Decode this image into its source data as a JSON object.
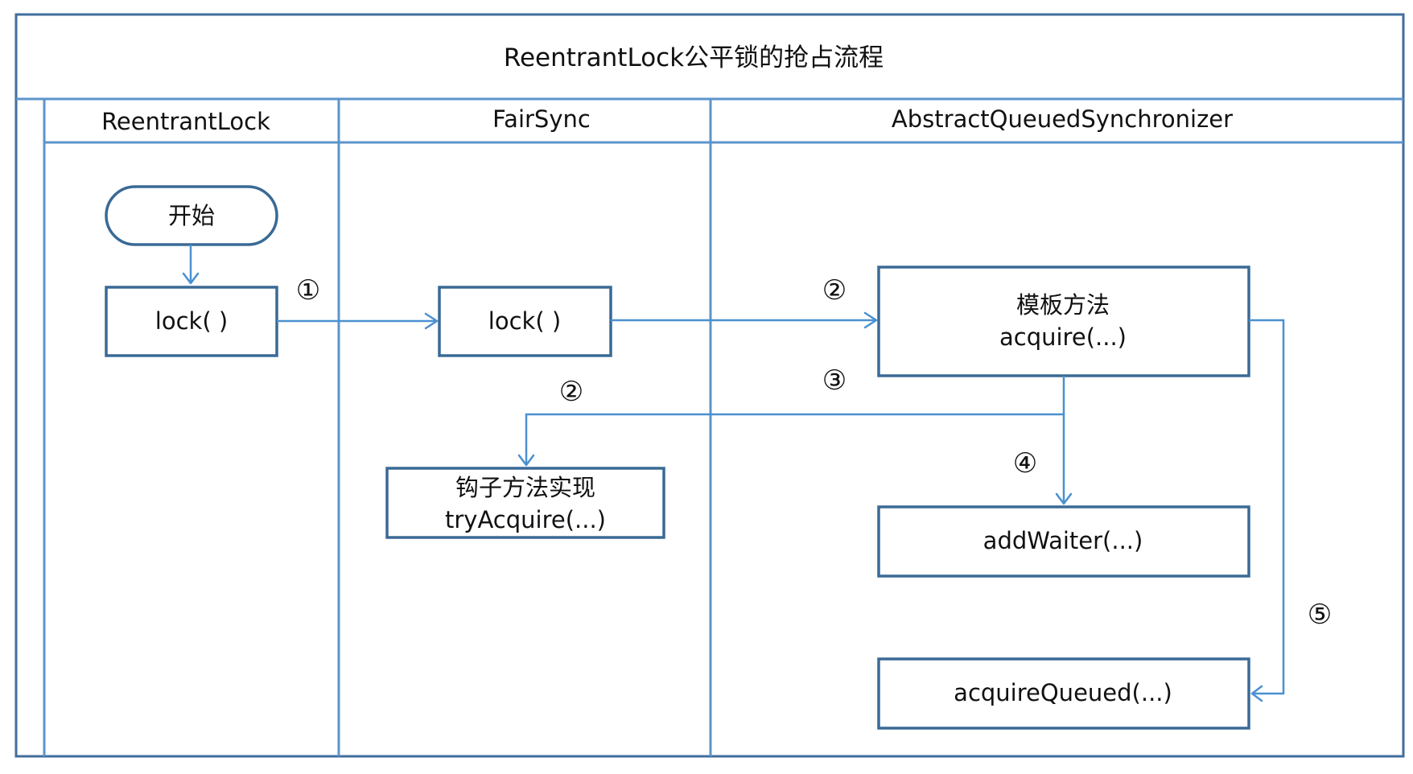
{
  "title": "ReentrantLock公平锁的抢占流程",
  "lanes": [
    {
      "label": "ReentrantLock"
    },
    {
      "label": "FairSync"
    },
    {
      "label": "AbstractQueuedSynchronizer"
    }
  ],
  "nodes": {
    "start": "开始",
    "lock_reentrant": "lock( )",
    "lock_fairsync": "lock( )",
    "template_title": "模板方法",
    "template_method": "acquire(...)",
    "hook_title": "钩子方法实现",
    "hook_method": "tryAcquire(...)",
    "add_waiter": "addWaiter(...)",
    "acquire_queued": "acquireQueued(...)"
  },
  "steps": {
    "s1": "①",
    "s2_top": "②",
    "s2_left": "②",
    "s3": "③",
    "s4": "④",
    "s5": "⑤"
  },
  "colors": {
    "frame": "#3f6e9c",
    "lane_divider": "#5c94cc",
    "arrow": "#4a90d0",
    "box_border": "#3a6a96"
  }
}
